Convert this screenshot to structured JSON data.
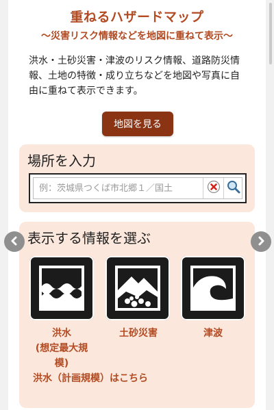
{
  "header": {
    "title": "重ねるハザードマップ",
    "subtitle": "〜災害リスク情報などを地図に重ねて表示〜"
  },
  "description": "洪水・土砂災害・津波のリスク情報、道路防災情報、土地の特徴・成り立ちなどを地図や写真に自由に重ねて表示できます。",
  "map_button": {
    "label": "地図を見る"
  },
  "place": {
    "title": "場所を入力",
    "search": {
      "placeholder": "例：茨城県つくば市北郷１／国土",
      "value": ""
    }
  },
  "info": {
    "title": "表示する情報を選ぶ",
    "items": [
      {
        "label": "洪水\n(想定最大規模)",
        "icon": "flood-icon"
      },
      {
        "label": "土砂災害",
        "icon": "landslide-icon"
      },
      {
        "label": "津波",
        "icon": "tsunami-icon"
      }
    ],
    "plan_link": "洪水（計画規模）はこちら"
  },
  "colors": {
    "accent": "#b24a22",
    "button_bg": "#8a3414",
    "panel_bg": "#fbe7db"
  }
}
